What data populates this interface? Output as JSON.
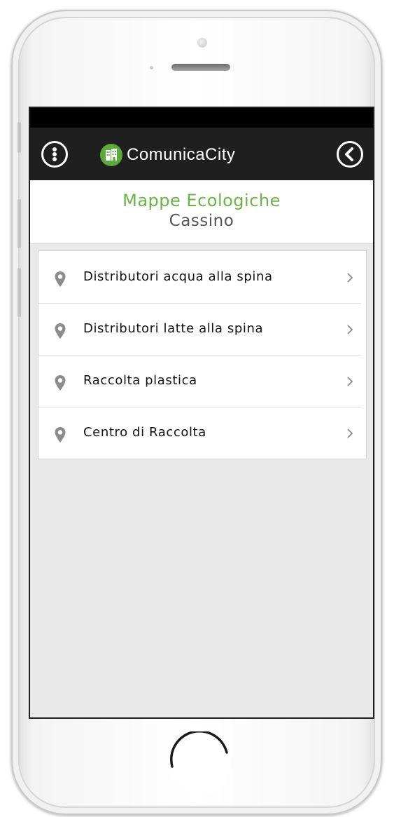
{
  "app": {
    "name": "ComunicaCity"
  },
  "header": {
    "title": "Mappe Ecologiche",
    "subtitle": "Cassino"
  },
  "list": {
    "items": [
      {
        "label": "Distributori acqua alla spina",
        "icon": "map-pin-icon"
      },
      {
        "label": "Distributori latte alla spina",
        "icon": "map-pin-icon"
      },
      {
        "label": "Raccolta plastica",
        "icon": "map-pin-icon"
      },
      {
        "label": "Centro di Raccolta",
        "icon": "map-pin-icon"
      }
    ]
  },
  "colors": {
    "accent_green": "#6ab445",
    "app_bar": "#1f1f1f",
    "logo_green": "#5aab37"
  }
}
